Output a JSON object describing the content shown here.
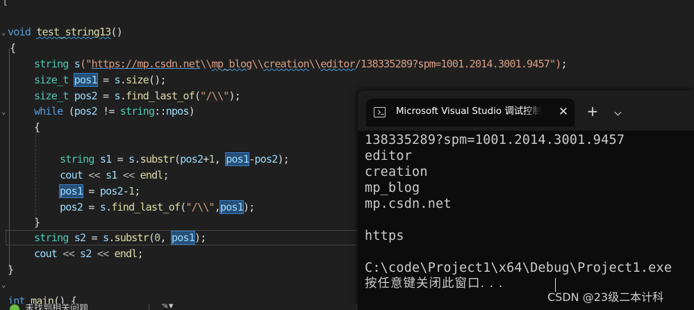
{
  "editor": {
    "lines": [
      {
        "tokens": [
          {
            "t": "[",
            "c": "op"
          }
        ]
      },
      {
        "tokens": [
          {
            "t": "void",
            "c": "kw"
          },
          {
            "t": " ",
            "c": "plain"
          },
          {
            "t": "test_string13",
            "c": "fn squig"
          },
          {
            "t": "()",
            "c": "plain"
          }
        ]
      },
      {
        "tokens": [
          {
            "t": "{",
            "c": "plain"
          }
        ]
      },
      {
        "tokens": [
          {
            "t": "string",
            "c": "ty"
          },
          {
            "t": " ",
            "c": "plain"
          },
          {
            "t": "s",
            "c": "var"
          },
          {
            "t": "(\"",
            "c": "str"
          },
          {
            "t": "https://mp.csdn.net",
            "c": "str url"
          },
          {
            "t": "\\\\",
            "c": "str"
          },
          {
            "t": "mp_blog",
            "c": "str squig"
          },
          {
            "t": "\\\\",
            "c": "str"
          },
          {
            "t": "creation",
            "c": "str squig"
          },
          {
            "t": "\\\\",
            "c": "str"
          },
          {
            "t": "editor",
            "c": "str squig"
          },
          {
            "t": "/138335289?spm=1001.2014.3001.9457\")",
            "c": "str"
          },
          {
            "t": ";",
            "c": "plain"
          }
        ]
      },
      {
        "tokens": [
          {
            "t": "size_t",
            "c": "ty"
          },
          {
            "t": " ",
            "c": "plain"
          },
          {
            "t": "pos1",
            "c": "hl"
          },
          {
            "t": " = ",
            "c": "plain"
          },
          {
            "t": "s",
            "c": "var"
          },
          {
            "t": ".",
            "c": "plain"
          },
          {
            "t": "size",
            "c": "fn"
          },
          {
            "t": "();",
            "c": "plain"
          }
        ]
      },
      {
        "tokens": [
          {
            "t": "size_t",
            "c": "ty"
          },
          {
            "t": " ",
            "c": "plain"
          },
          {
            "t": "pos2",
            "c": "var"
          },
          {
            "t": " = ",
            "c": "plain"
          },
          {
            "t": "s",
            "c": "var"
          },
          {
            "t": ".",
            "c": "plain"
          },
          {
            "t": "find_last_of",
            "c": "fn"
          },
          {
            "t": "(",
            "c": "plain"
          },
          {
            "t": "\"/\\\\\"",
            "c": "str"
          },
          {
            "t": ");",
            "c": "plain"
          }
        ]
      },
      {
        "tokens": [
          {
            "t": "while",
            "c": "kw"
          },
          {
            "t": " (",
            "c": "plain"
          },
          {
            "t": "pos2",
            "c": "var"
          },
          {
            "t": " != ",
            "c": "plain"
          },
          {
            "t": "string",
            "c": "ty"
          },
          {
            "t": "::",
            "c": "plain"
          },
          {
            "t": "npos",
            "c": "var"
          },
          {
            "t": ")",
            "c": "plain"
          }
        ]
      },
      {
        "tokens": [
          {
            "t": "{",
            "c": "plain"
          }
        ]
      },
      {
        "tokens": []
      },
      {
        "tokens": [
          {
            "t": "string",
            "c": "ty"
          },
          {
            "t": " ",
            "c": "plain"
          },
          {
            "t": "s1",
            "c": "var"
          },
          {
            "t": " = ",
            "c": "plain"
          },
          {
            "t": "s",
            "c": "var"
          },
          {
            "t": ".",
            "c": "plain"
          },
          {
            "t": "substr",
            "c": "fn"
          },
          {
            "t": "(",
            "c": "plain"
          },
          {
            "t": "pos2",
            "c": "var"
          },
          {
            "t": "+",
            "c": "plain"
          },
          {
            "t": "1",
            "c": "num"
          },
          {
            "t": ", ",
            "c": "plain"
          },
          {
            "t": "pos1",
            "c": "hl"
          },
          {
            "t": "-",
            "c": "plain"
          },
          {
            "t": "pos2",
            "c": "var"
          },
          {
            "t": ");",
            "c": "plain"
          }
        ]
      },
      {
        "tokens": [
          {
            "t": "cout",
            "c": "var"
          },
          {
            "t": " << ",
            "c": "op"
          },
          {
            "t": "s1",
            "c": "var"
          },
          {
            "t": " << ",
            "c": "op"
          },
          {
            "t": "endl",
            "c": "fn"
          },
          {
            "t": ";",
            "c": "plain"
          }
        ]
      },
      {
        "tokens": [
          {
            "t": "pos1",
            "c": "hl"
          },
          {
            "t": " = ",
            "c": "plain"
          },
          {
            "t": "pos2",
            "c": "var"
          },
          {
            "t": "-",
            "c": "plain"
          },
          {
            "t": "1",
            "c": "num"
          },
          {
            "t": ";",
            "c": "plain"
          }
        ]
      },
      {
        "tokens": [
          {
            "t": "pos2",
            "c": "var"
          },
          {
            "t": " = ",
            "c": "plain"
          },
          {
            "t": "s",
            "c": "var"
          },
          {
            "t": ".",
            "c": "plain"
          },
          {
            "t": "find_last_of",
            "c": "fn"
          },
          {
            "t": "(",
            "c": "plain"
          },
          {
            "t": "\"/\\\\\"",
            "c": "str"
          },
          {
            "t": ",",
            "c": "plain"
          },
          {
            "t": "pos1",
            "c": "hl"
          },
          {
            "t": ");",
            "c": "plain"
          }
        ]
      },
      {
        "tokens": [
          {
            "t": "}",
            "c": "plain"
          }
        ]
      },
      {
        "tokens": [
          {
            "t": "string",
            "c": "ty"
          },
          {
            "t": " ",
            "c": "plain"
          },
          {
            "t": "s2",
            "c": "var"
          },
          {
            "t": " = ",
            "c": "plain"
          },
          {
            "t": "s",
            "c": "var"
          },
          {
            "t": ".",
            "c": "plain"
          },
          {
            "t": "substr",
            "c": "fn"
          },
          {
            "t": "(",
            "c": "plain"
          },
          {
            "t": "0",
            "c": "num"
          },
          {
            "t": ", ",
            "c": "plain"
          },
          {
            "t": "pos1",
            "c": "hl"
          },
          {
            "t": ");",
            "c": "plain"
          }
        ]
      },
      {
        "tokens": [
          {
            "t": "cout",
            "c": "var"
          },
          {
            "t": " << ",
            "c": "op"
          },
          {
            "t": "s2",
            "c": "var"
          },
          {
            "t": " << ",
            "c": "op"
          },
          {
            "t": "endl",
            "c": "fn"
          },
          {
            "t": ";",
            "c": "plain"
          }
        ]
      },
      {
        "tokens": [
          {
            "t": "}",
            "c": "plain"
          }
        ]
      },
      {
        "tokens": [
          {
            "t": "int",
            "c": "kw"
          },
          {
            "t": " ",
            "c": "plain"
          },
          {
            "t": "main",
            "c": "fn"
          },
          {
            "t": "() {",
            "c": "plain"
          }
        ]
      }
    ]
  },
  "terminal": {
    "tab_title": "Microsoft Visual Studio 调试控制台",
    "close_glyph": "✕",
    "new_tab_glyph": "+",
    "icon": "terminal-icon",
    "output": [
      "138335289?spm=1001.2014.3001.9457",
      "editor",
      "creation",
      "mp_blog",
      "mp.csdn.net",
      "",
      "https",
      "",
      "C:\\code\\Project1\\x64\\Debug\\Project1.exe",
      "按任意键关闭此窗口. . ."
    ]
  },
  "statusbar": {
    "issues_label": "未找到相关问题"
  },
  "watermark": "CSDN @23级二本计科",
  "colors": {
    "editor_bg": "#1f1f1f",
    "terminal_bg": "#0c0c0c",
    "keyword": "#569cd6",
    "type": "#4ec9b0",
    "function": "#dcdcaa",
    "string": "#d69d85",
    "variable": "#9cdcfe",
    "highlight": "#264f78"
  }
}
